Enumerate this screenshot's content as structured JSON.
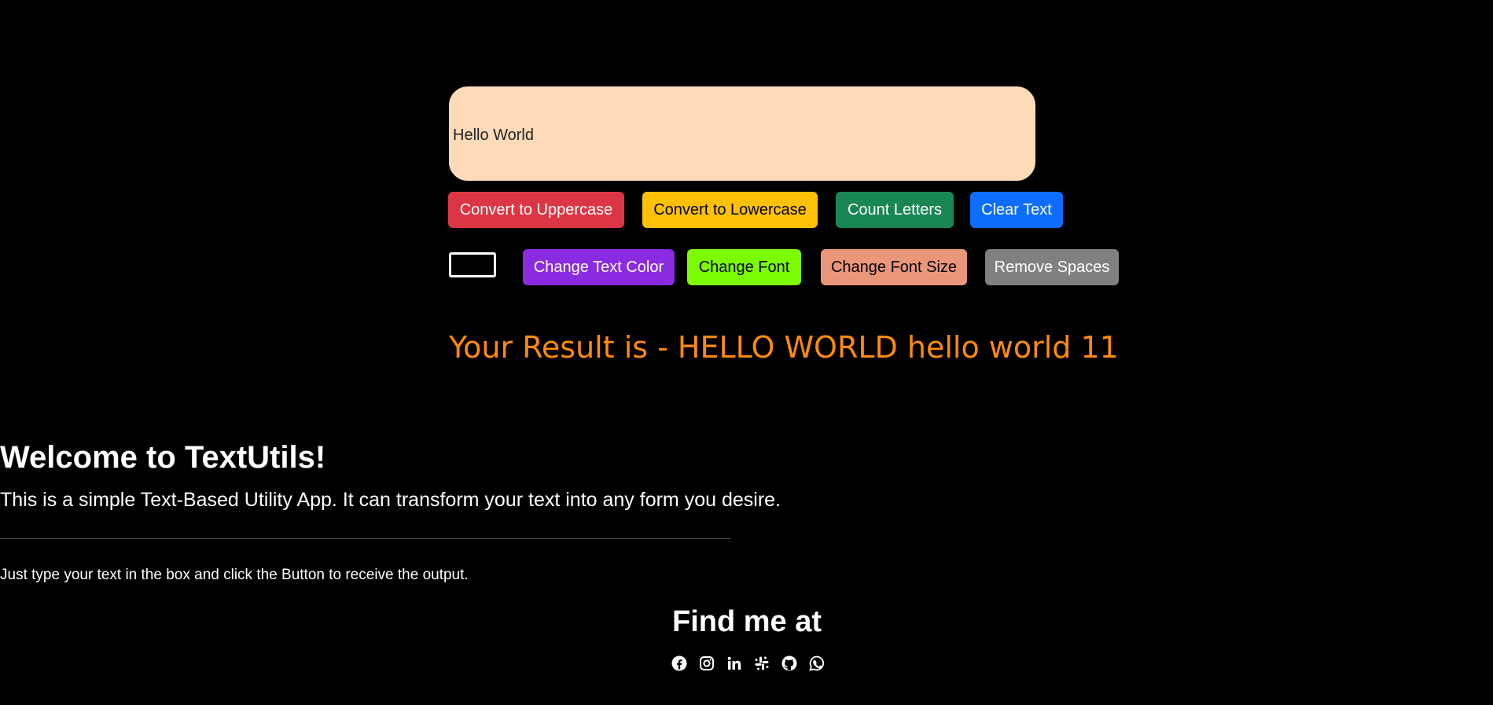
{
  "editor": {
    "value": "Hello World"
  },
  "actions_row1": [
    {
      "label": "Convert to Uppercase",
      "bg": "#dc3545",
      "fg": "#ffffff"
    },
    {
      "label": "Convert to Lowercase",
      "bg": "#ffc107",
      "fg": "#000000"
    },
    {
      "label": "Count Letters",
      "bg": "#198754",
      "fg": "#ffffff"
    },
    {
      "label": "Clear Text",
      "bg": "#0d6efd",
      "fg": "#ffffff"
    }
  ],
  "actions_row2": [
    {
      "label": "Change Text Color",
      "bg": "#8a2be2",
      "fg": "#ffffff"
    },
    {
      "label": "Change Font",
      "bg": "#7cfc00",
      "fg": "#000000"
    },
    {
      "label": "Change Font Size",
      "bg": "#e9967a",
      "fg": "#000000"
    },
    {
      "label": "Remove Spaces",
      "bg": "#808080",
      "fg": "#ffffff"
    }
  ],
  "color_picker": {
    "value": "#000000"
  },
  "result": {
    "text": "Your Result is - HELLO WORLD hello world 11",
    "color": "#ff8a0d"
  },
  "welcome": {
    "title": "Welcome to TextUtils!",
    "lead": "This is a simple Text-Based Utility App. It can transform your text into any form you desire.",
    "note": "Just type your text in the box and click the Button to receive the output."
  },
  "footer": {
    "title": "Find me at",
    "socials": [
      "facebook-icon",
      "instagram-icon",
      "linkedin-icon",
      "slack-icon",
      "github-icon",
      "whatsapp-icon"
    ]
  }
}
